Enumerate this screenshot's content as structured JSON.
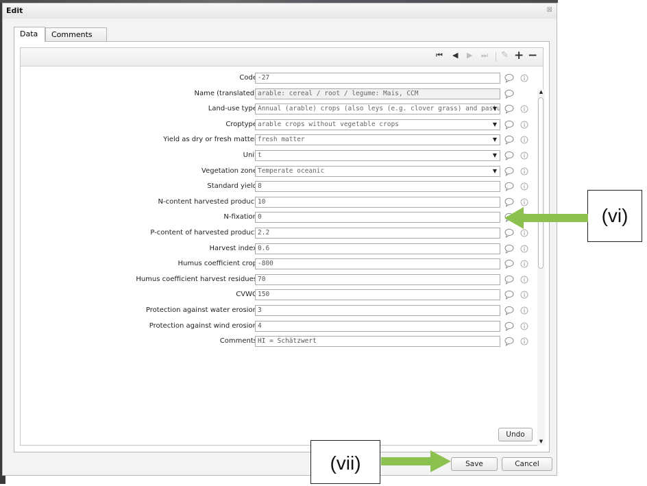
{
  "dialog": {
    "title": "Edit",
    "close": "⊠"
  },
  "tabs": [
    {
      "label": "Data"
    },
    {
      "label": "Comments"
    }
  ],
  "toolbar": {
    "first": "⏮",
    "prev": "◀",
    "next": "▶",
    "last": "⏭",
    "edit": "✎",
    "add": "+",
    "remove": "−"
  },
  "fields": [
    {
      "label": "Code",
      "value": "-27",
      "type": "text",
      "info": true
    },
    {
      "label": "Name (translated)",
      "value": "arable: cereal / root / legume: Mais, CCM",
      "type": "readonly",
      "info": false
    },
    {
      "label": "Land-use type",
      "value": "Annual (arable) crops (also leys (e.g. clover grass) and pastur→",
      "type": "select",
      "info": true
    },
    {
      "label": "Croptype",
      "value": "arable crops without vegetable crops",
      "type": "select",
      "info": true
    },
    {
      "label": "Yield as dry or fresh matter",
      "value": "fresh matter",
      "type": "select",
      "info": true
    },
    {
      "label": "Unit",
      "value": "t",
      "type": "select",
      "info": true
    },
    {
      "label": "Vegetation zone",
      "value": "Temperate oceanic",
      "type": "select",
      "info": true
    },
    {
      "label": "Standard yield",
      "value": "8",
      "type": "text",
      "info": true
    },
    {
      "label": "N-content harvested product",
      "value": "10",
      "type": "text",
      "info": true
    },
    {
      "label": "N-fixation",
      "value": "0",
      "type": "text",
      "info": true
    },
    {
      "label": "P-content of harvested product",
      "value": "2.2",
      "type": "text",
      "info": true
    },
    {
      "label": "Harvest index",
      "value": "0.6",
      "type": "text",
      "info": true
    },
    {
      "label": "Humus coefficient crop",
      "value": "-800",
      "type": "text",
      "info": true
    },
    {
      "label": "Humus coefficient harvest residues",
      "value": "70",
      "type": "text",
      "info": true
    },
    {
      "label": "CVWC",
      "value": "150",
      "type": "text",
      "info": true
    },
    {
      "label": "Protection against water erosion",
      "value": "3",
      "type": "text",
      "info": true
    },
    {
      "label": "Protection against wind erosion",
      "value": "4",
      "type": "text",
      "info": true
    },
    {
      "label": "Comments",
      "value": "HI = Schätzwert",
      "type": "text",
      "info": true
    }
  ],
  "buttons": {
    "undo": "Undo",
    "save": "Save",
    "cancel": "Cancel"
  },
  "annotations": {
    "vi": "(vi)",
    "vii": "(vii)",
    "arrow_color": "#8dc14f"
  }
}
